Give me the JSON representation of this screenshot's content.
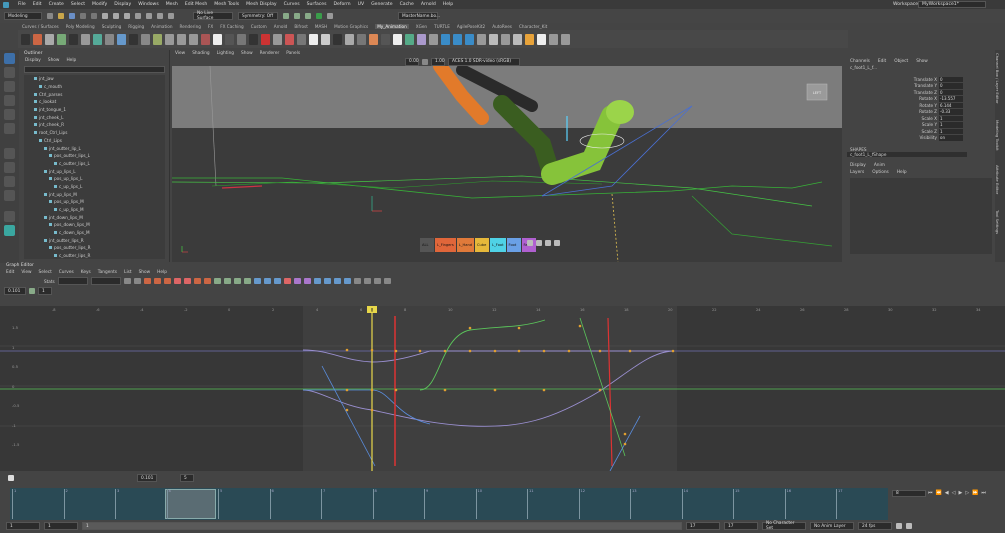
{
  "menubar": {
    "items": [
      "File",
      "Edit",
      "Create",
      "Select",
      "Modify",
      "Display",
      "Windows",
      "Mesh",
      "Edit Mesh",
      "Mesh Tools",
      "Mesh Display",
      "Curves",
      "Surfaces",
      "Deform",
      "UV",
      "Generate",
      "Cache",
      "Arnold",
      "Help"
    ],
    "workspace_label": "Workspace:",
    "workspace_value": "MyWorkspace1*"
  },
  "status": {
    "mode": "Modeling",
    "live": "No Live Surface",
    "symmetry": "Symmetry: Off",
    "camera": "MasterName.bo..."
  },
  "shelf": {
    "tabs": [
      "Curves / Surfaces",
      "Poly Modeling",
      "Sculpting",
      "Rigging",
      "Animation",
      "Rendering",
      "FX",
      "FX Caching",
      "Custom",
      "Arnold",
      "Bifrost",
      "MASH",
      "Motion Graphics",
      "My_Animation",
      "XGen",
      "TURTLE",
      "AgilePoseKit2",
      "AutoRees",
      "Character_Kit"
    ],
    "active_tab": "My_Animation"
  },
  "outliner": {
    "title": "Outliner",
    "menu": [
      "Display",
      "Show",
      "Help"
    ],
    "items": [
      {
        "label": "jnt_jaw",
        "indent": 2
      },
      {
        "label": "c_mouth",
        "indent": 3
      },
      {
        "label": "Ctrl_parses",
        "indent": 2
      },
      {
        "label": "c_lookat",
        "indent": 2
      },
      {
        "label": "jnt_tongue_1",
        "indent": 2
      },
      {
        "label": "jnt_cheek_L",
        "indent": 2
      },
      {
        "label": "jnt_cheek_R",
        "indent": 2
      },
      {
        "label": "root_Ctrl_Lips",
        "indent": 2
      },
      {
        "label": "Ctrl_Lips",
        "indent": 3
      },
      {
        "label": "jnt_outter_lip_L",
        "indent": 4
      },
      {
        "label": "pos_outter_lips_L",
        "indent": 5
      },
      {
        "label": "c_outter_lips_L",
        "indent": 6
      },
      {
        "label": "jnt_up_lips_L",
        "indent": 4
      },
      {
        "label": "pos_up_lips_L",
        "indent": 5
      },
      {
        "label": "c_up_lips_L",
        "indent": 6
      },
      {
        "label": "jnt_up_lips_M",
        "indent": 4
      },
      {
        "label": "pos_up_lips_M",
        "indent": 5
      },
      {
        "label": "c_up_lips_M",
        "indent": 6
      },
      {
        "label": "jnt_down_lips_M",
        "indent": 4
      },
      {
        "label": "pos_down_lips_M",
        "indent": 5
      },
      {
        "label": "c_down_lips_M",
        "indent": 6
      },
      {
        "label": "jnt_outter_lips_R",
        "indent": 4
      },
      {
        "label": "pos_outter_lips_R",
        "indent": 5
      },
      {
        "label": "c_outter_lips_R",
        "indent": 6
      }
    ]
  },
  "viewport": {
    "menu": [
      "View",
      "Shading",
      "Lighting",
      "Show",
      "Renderer",
      "Panels"
    ],
    "exposure": "0.00",
    "gamma": "1.00",
    "colorspace": "ACES 1.0 SDR-video (sRGB)",
    "cube_label": "LEFT",
    "chips": [
      {
        "label": "ALL",
        "color": "#555555"
      },
      {
        "label": "L_Fingers",
        "color": "#e0663a"
      },
      {
        "label": "L_Hand",
        "color": "#e07a3a"
      },
      {
        "label": "Cube",
        "color": "#e6b83a"
      },
      {
        "label": "L_Foot",
        "color": "#4fd2e6"
      },
      {
        "label": "Foot",
        "color": "#6aa0e6"
      },
      {
        "label": "Face",
        "color": "#b060d0"
      }
    ]
  },
  "channels": {
    "menu": [
      "Channels",
      "Edit",
      "Object",
      "Show"
    ],
    "node": "c_foot1_L_f...",
    "attrs": [
      {
        "name": "Translate X",
        "value": "0"
      },
      {
        "name": "Translate Y",
        "value": "0"
      },
      {
        "name": "Translate Z",
        "value": "0"
      },
      {
        "name": "Rotate X",
        "value": "-13.557"
      },
      {
        "name": "Rotate Y",
        "value": "6.144"
      },
      {
        "name": "Rotate Z",
        "value": "-0.33"
      },
      {
        "name": "Scale X",
        "value": "1"
      },
      {
        "name": "Scale Y",
        "value": "1"
      },
      {
        "name": "Scale Z",
        "value": "1"
      },
      {
        "name": "Visibility",
        "value": "on"
      }
    ],
    "shapes_label": "SHAPES",
    "shape_node": "c_foot1_L_fShape",
    "layer_tabs": [
      "Display",
      "Anim"
    ],
    "layer_menu": [
      "Layers",
      "Options",
      "Help"
    ]
  },
  "side_tabs": [
    "Channel Box / Layer Editor",
    "Modeling Toolkit",
    "Attribute Editor",
    "Tool Settings"
  ],
  "graph_editor": {
    "title": "Graph Editor",
    "menu": [
      "Edit",
      "View",
      "Select",
      "Curves",
      "Keys",
      "Tangents",
      "List",
      "Show",
      "Help"
    ],
    "stats_label": "Stats",
    "frame_value": "0.101",
    "value_field": "1",
    "y_labels": [
      "1.5",
      "1",
      "0.5",
      "0",
      "-0.5",
      "-1",
      "-1.5"
    ],
    "x_labels": [
      "-8",
      "-6",
      "-4",
      "-2",
      "0",
      "2",
      "4",
      "6",
      "8",
      "10",
      "12",
      "14",
      "16",
      "18",
      "20",
      "22",
      "24",
      "26",
      "28",
      "30",
      "32",
      "34"
    ],
    "current_frame_label": "8",
    "time_field": "0.101",
    "time_value": "5"
  },
  "timeline": {
    "ticks": [
      "1",
      "2",
      "3",
      "4",
      "5",
      "6",
      "7",
      "8",
      "9",
      "10",
      "11",
      "12",
      "13",
      "14",
      "15",
      "16",
      "17"
    ],
    "current_frame": "8",
    "current_field": "8",
    "start": "1",
    "range_start": "1",
    "range_end": "17",
    "end": "17",
    "end2": "17",
    "character_set": "No Character Set",
    "anim_layer": "No Anim Layer",
    "fps": "24 fps"
  }
}
